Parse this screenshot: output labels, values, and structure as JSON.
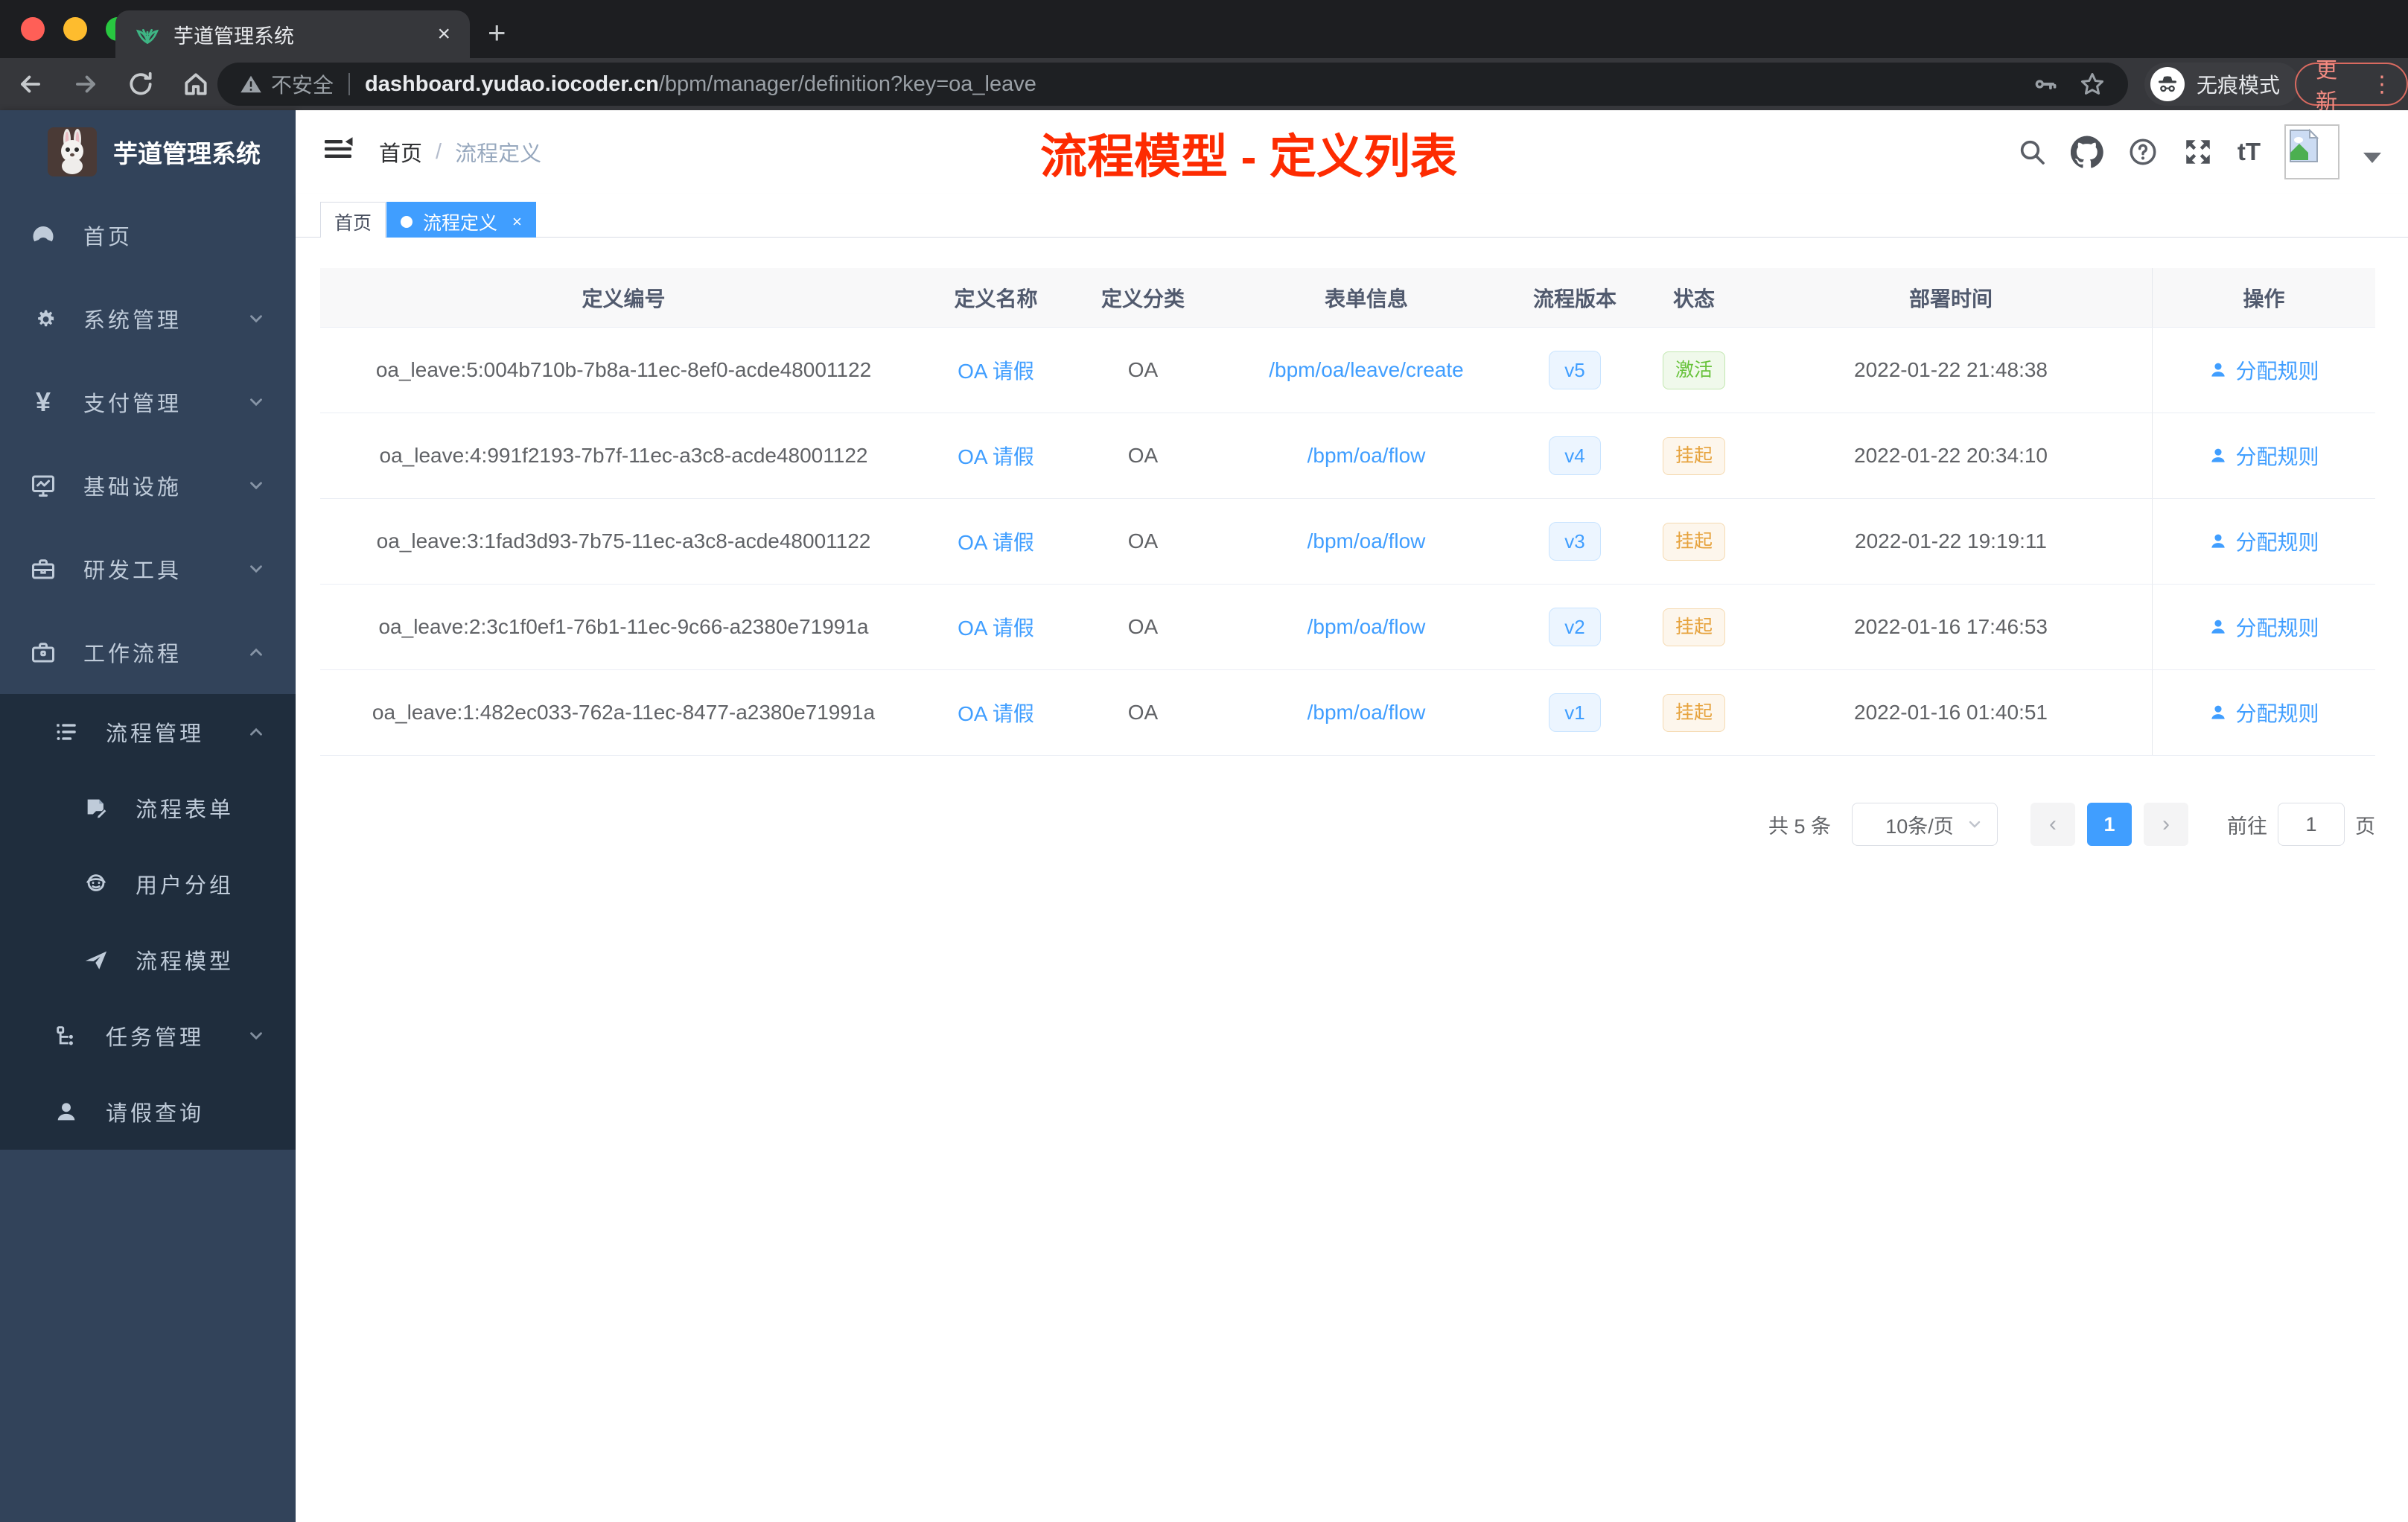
{
  "browser": {
    "tab_title": "芋道管理系统",
    "security_warning": "不安全",
    "url_host": "dashboard.yudao.iocoder.cn",
    "url_path": "/bpm/manager/definition?key=oa_leave",
    "incognito_label": "无痕模式",
    "update_label": "更新"
  },
  "icons": {
    "close": "×",
    "new_tab": "+",
    "kebab": "⋮",
    "yen": "¥",
    "font_size": "tT",
    "prev_arrow": "‹",
    "next_arrow": "›"
  },
  "sidebar": {
    "app_title": "芋道管理系统",
    "menu": [
      {
        "label": "首页"
      },
      {
        "label": "系统管理"
      },
      {
        "label": "支付管理"
      },
      {
        "label": "基础设施"
      },
      {
        "label": "研发工具"
      },
      {
        "label": "工作流程"
      }
    ],
    "workflow_submenu": {
      "process_management": {
        "label": "流程管理"
      },
      "children": [
        {
          "label": "流程表单"
        },
        {
          "label": "用户分组"
        },
        {
          "label": "流程模型"
        }
      ],
      "task_management": {
        "label": "任务管理"
      },
      "leave_query": {
        "label": "请假查询"
      }
    }
  },
  "navbar": {
    "breadcrumb": {
      "home": "首页",
      "separator": "/",
      "current": "流程定义"
    },
    "annotation": "流程模型 - 定义列表",
    "annotation_color": "#fd2b01"
  },
  "tags": {
    "home": "首页",
    "active": "流程定义"
  },
  "table": {
    "headers": [
      "定义编号",
      "定义名称",
      "定义分类",
      "表单信息",
      "流程版本",
      "状态",
      "部署时间",
      "操作"
    ],
    "rows": [
      {
        "id": "oa_leave:5:004b710b-7b8a-11ec-8ef0-acde48001122",
        "name": "OA 请假",
        "category": "OA",
        "form": "/bpm/oa/leave/create",
        "version": "v5",
        "status": "激活",
        "deploy_time": "2022-01-22 21:48:38",
        "action": "分配规则"
      },
      {
        "id": "oa_leave:4:991f2193-7b7f-11ec-a3c8-acde48001122",
        "name": "OA 请假",
        "category": "OA",
        "form": "/bpm/oa/flow",
        "version": "v4",
        "status": "挂起",
        "deploy_time": "2022-01-22 20:34:10",
        "action": "分配规则"
      },
      {
        "id": "oa_leave:3:1fad3d93-7b75-11ec-a3c8-acde48001122",
        "name": "OA 请假",
        "category": "OA",
        "form": "/bpm/oa/flow",
        "version": "v3",
        "status": "挂起",
        "deploy_time": "2022-01-22 19:19:11",
        "action": "分配规则"
      },
      {
        "id": "oa_leave:2:3c1f0ef1-76b1-11ec-9c66-a2380e71991a",
        "name": "OA 请假",
        "category": "OA",
        "form": "/bpm/oa/flow",
        "version": "v2",
        "status": "挂起",
        "deploy_time": "2022-01-16 17:46:53",
        "action": "分配规则"
      },
      {
        "id": "oa_leave:1:482ec033-762a-11ec-8477-a2380e71991a",
        "name": "OA 请假",
        "category": "OA",
        "form": "/bpm/oa/flow",
        "version": "v1",
        "status": "挂起",
        "deploy_time": "2022-01-16 01:40:51",
        "action": "分配规则"
      }
    ]
  },
  "pagination": {
    "total": "共 5 条",
    "page_size": "10条/页",
    "page": "1",
    "goto_label": "前往",
    "goto_value": "1",
    "page_unit": "页"
  },
  "colors": {
    "primary": "#409eff",
    "status_active": "#67c23a",
    "status_suspended": "#e6a23c",
    "sidebar_bg": "#32435a",
    "submenu_bg": "#1f2d3d",
    "annotation_red": "#fd2b01"
  }
}
